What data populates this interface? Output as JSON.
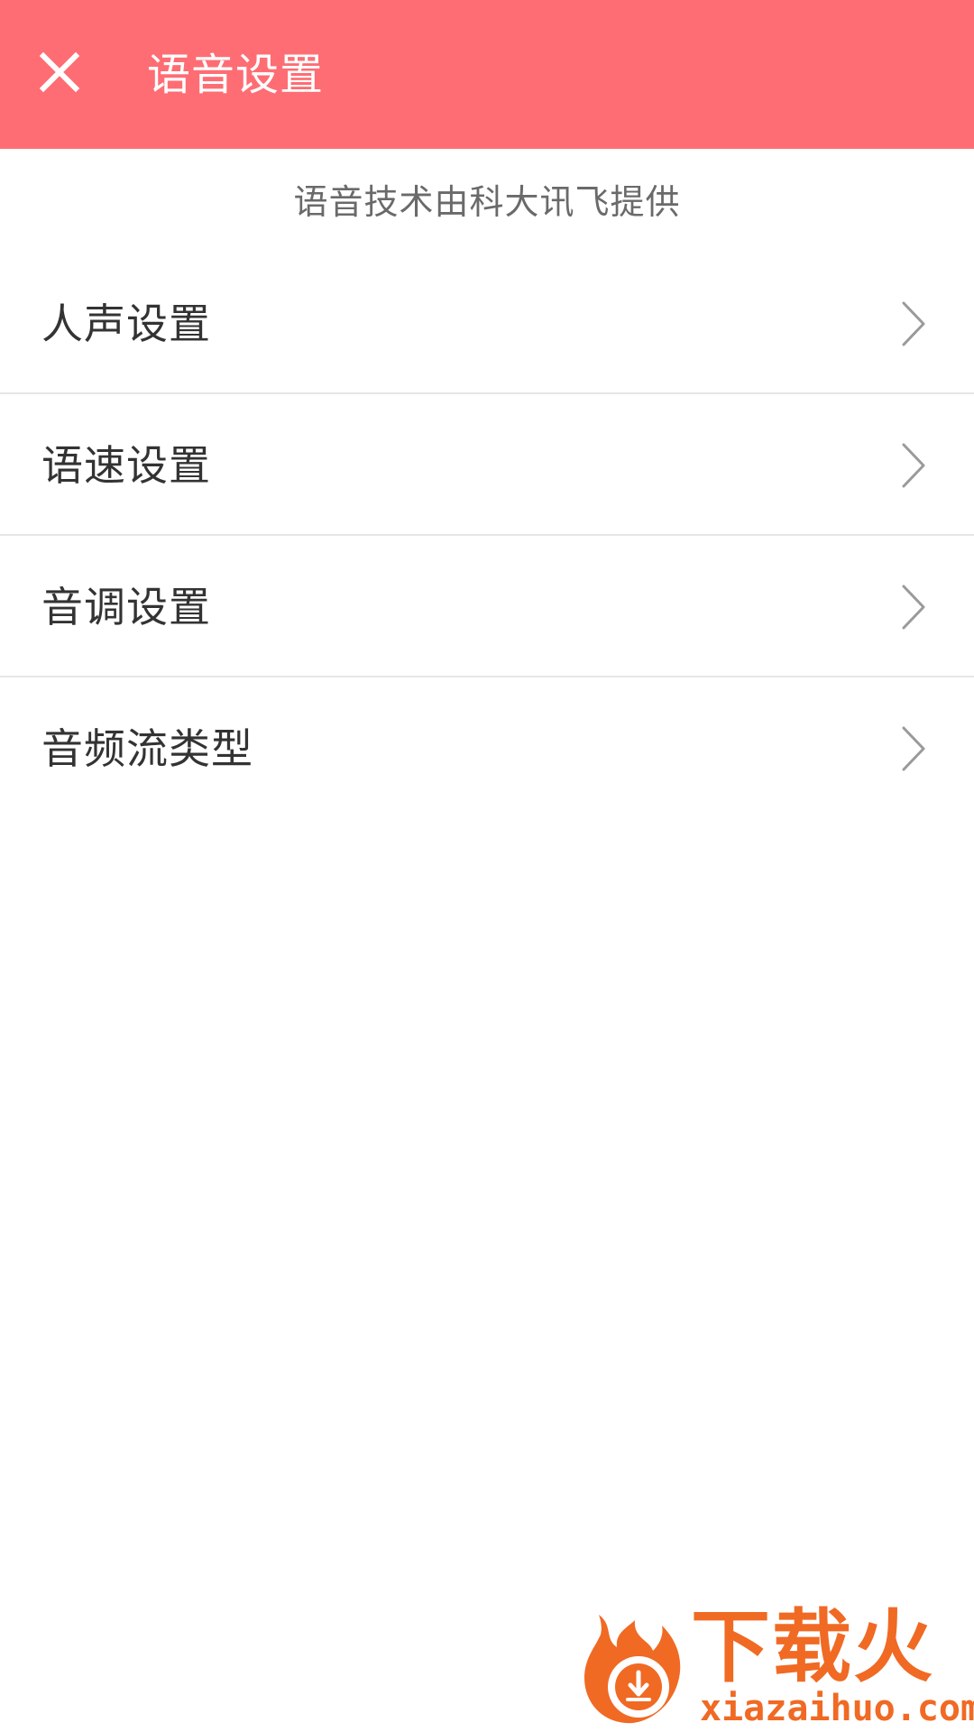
{
  "app_bar": {
    "close_icon": "close-icon",
    "title": "语音设置",
    "background_color": "#fe6d73"
  },
  "provider_note": "语音技术由科大讯飞提供",
  "settings_list": {
    "chevron_icon": "chevron-right-icon",
    "items": [
      {
        "label": "人声设置"
      },
      {
        "label": "语速设置"
      },
      {
        "label": "音调设置"
      },
      {
        "label": "音频流类型"
      }
    ]
  },
  "watermark": {
    "brand": "下载火",
    "url": "xiazaihuo.com",
    "logo_icon": "flame-download-logo",
    "color": "#f06a24"
  }
}
